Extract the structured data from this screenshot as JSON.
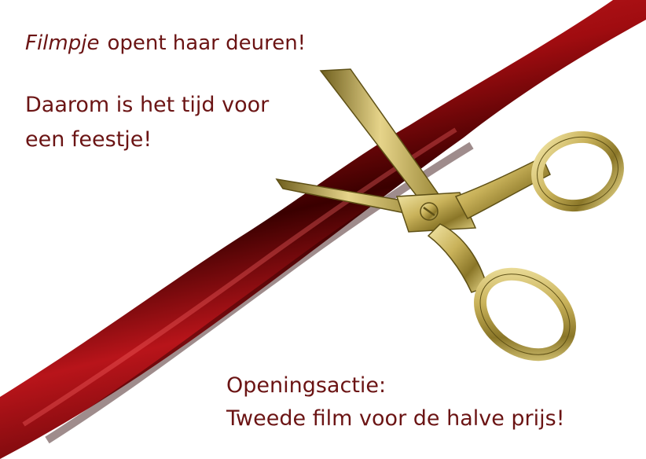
{
  "headline": {
    "brand": "Filmpje",
    "rest": "opent haar deuren!"
  },
  "tagline": {
    "line1": "Daarom is het tijd voor",
    "line2": "een feestje!"
  },
  "promo": {
    "line1": "Openingsactie:",
    "line2": "Tweede film voor de halve prijs!"
  },
  "illustration": {
    "ribbon_icon": "red-ribbon",
    "scissors_icon": "gold-scissors"
  },
  "colors": {
    "text": "#6b1414",
    "ribbon": "#c0141a",
    "ribbon_dark": "#4a0000",
    "gold": "#c9b25a",
    "gold_dark": "#7a6a24"
  }
}
